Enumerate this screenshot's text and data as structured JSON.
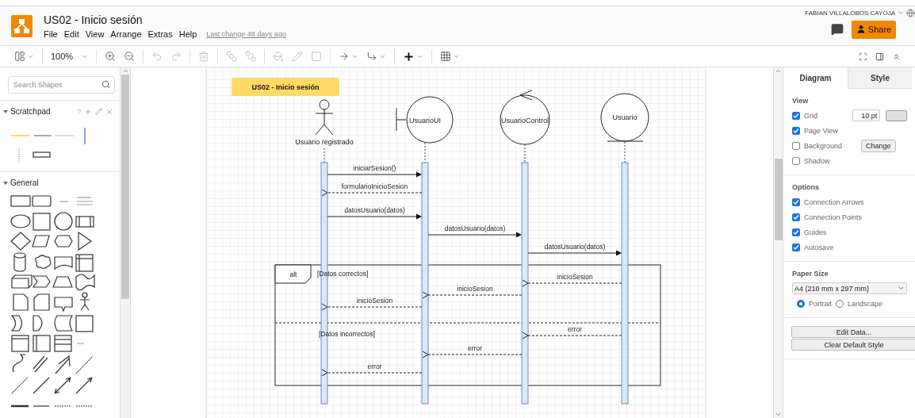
{
  "app": {
    "title": "US02 - Inicio sesión",
    "menu": [
      "File",
      "Edit",
      "View",
      "Arrange",
      "Extras",
      "Help"
    ],
    "last_change": "Last change 48 days ago",
    "user": "FABIAN VILLALOBOS CAYOJA",
    "share": "Share"
  },
  "toolbar": {
    "zoom": "100%"
  },
  "sidebar": {
    "search": {
      "placeholder": "Search Shapes"
    },
    "sections": [
      {
        "title": "Scratchpad",
        "help": "?",
        "expanded": true
      },
      {
        "title": "General",
        "expanded": true
      }
    ]
  },
  "diagram": {
    "title": "US02 - Inicio sesión",
    "lifelines": [
      {
        "kind": "actor",
        "label": "Usuario registrado"
      },
      {
        "kind": "boundary",
        "label": "UsuarioUI"
      },
      {
        "kind": "control",
        "label": "UsuarioControl"
      },
      {
        "kind": "entity",
        "label": "Usuario"
      }
    ],
    "messages": [
      {
        "label": "iniciarSesion()",
        "kind": "call"
      },
      {
        "label": "formularioInicioSesion",
        "kind": "return"
      },
      {
        "label": "datosUsuario(datos)",
        "kind": "call"
      },
      {
        "label": "datosUsuario(datos)",
        "kind": "call"
      },
      {
        "label": "datosUsuario(datos)",
        "kind": "call"
      }
    ],
    "fragment": {
      "operator": "alt",
      "operands": [
        {
          "guard": "[Datos correctos]",
          "messages": [
            {
              "label": "inicioSesion",
              "kind": "return"
            },
            {
              "label": "inicioSesion",
              "kind": "return"
            },
            {
              "label": "inicioSesion",
              "kind": "return"
            }
          ]
        },
        {
          "guard": "[Datos incorrectos]",
          "messages": [
            {
              "label": "error",
              "kind": "return"
            },
            {
              "label": "error",
              "kind": "return"
            },
            {
              "label": "error",
              "kind": "return"
            }
          ]
        }
      ]
    }
  },
  "format_panel": {
    "tabs": [
      {
        "label": "Diagram",
        "selected": true
      },
      {
        "label": "Style",
        "selected": false
      }
    ],
    "view": {
      "title": "View",
      "options": [
        {
          "label": "Grid",
          "checked": true
        },
        {
          "label": "Page View",
          "checked": true
        },
        {
          "label": "Background",
          "checked": false
        },
        {
          "label": "Shadow",
          "checked": false
        }
      ],
      "grid_size": "10 pt",
      "background_button": "Change"
    },
    "options": {
      "title": "Options",
      "items": [
        {
          "label": "Connection Arrows",
          "checked": true
        },
        {
          "label": "Connection Points",
          "checked": true
        },
        {
          "label": "Guides",
          "checked": true
        },
        {
          "label": "Autosave",
          "checked": true
        }
      ]
    },
    "paper": {
      "title": "Paper Size",
      "size": "A4 (210 mm x 297 mm)",
      "orientations": [
        {
          "label": "Portrait",
          "selected": true
        },
        {
          "label": "Landscape",
          "selected": false
        }
      ]
    },
    "buttons": [
      "Edit Data...",
      "Clear Default Style"
    ]
  }
}
